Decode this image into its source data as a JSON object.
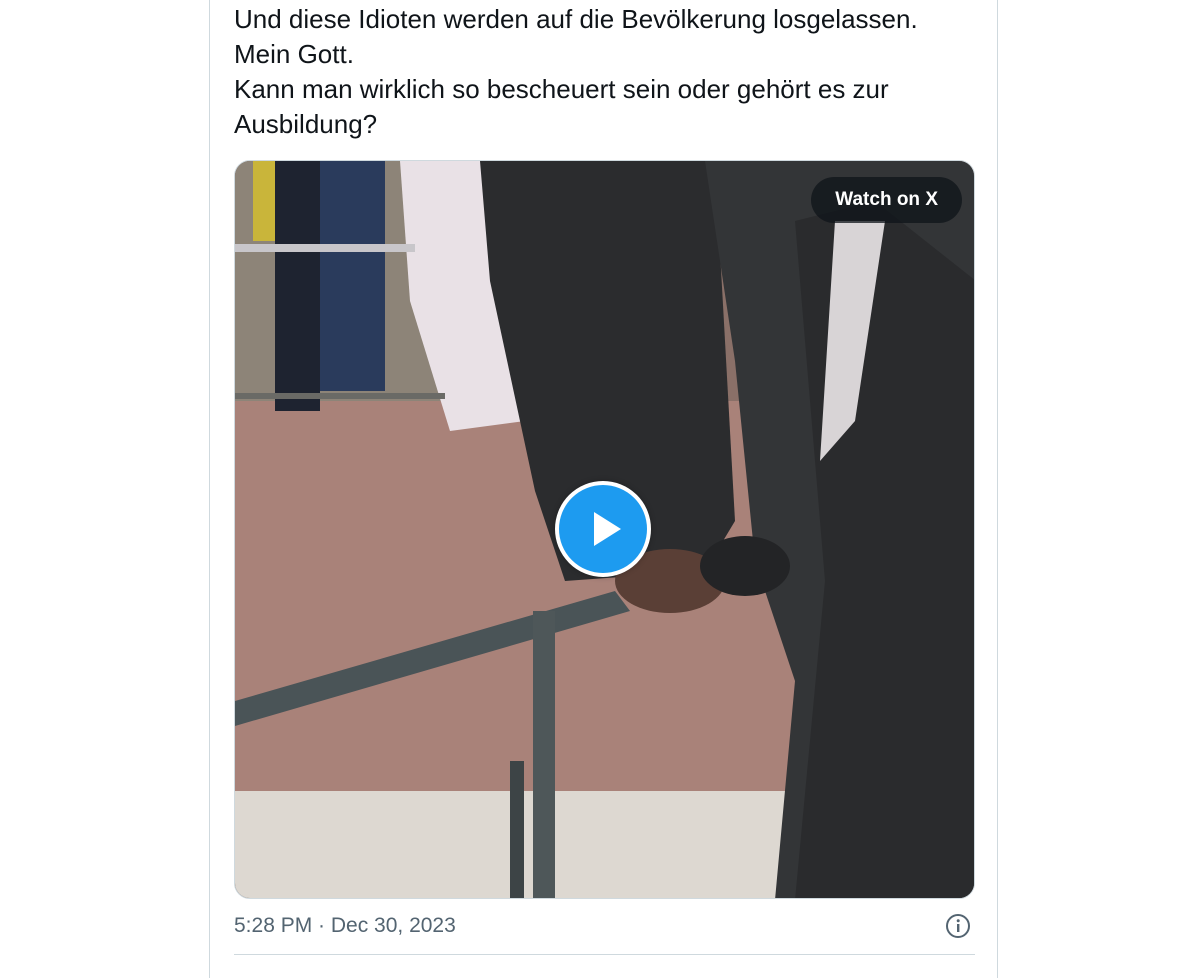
{
  "tweet": {
    "text_lines": [
      "Und diese Idioten werden auf die Bevölkerung losgelassen.",
      "Mein Gott.",
      "Kann man wirklich so bescheuert sein oder gehört es zur",
      "Ausbildung?"
    ],
    "media": {
      "watch_label": "Watch on X",
      "play_icon": "play-icon"
    },
    "timestamp": "5:28 PM · Dec 30, 2023",
    "info_icon": "info-icon"
  },
  "colors": {
    "text": "#0f1419",
    "secondary_text": "#536471",
    "accent": "#1d9bf0",
    "border": "#cfd9de"
  }
}
